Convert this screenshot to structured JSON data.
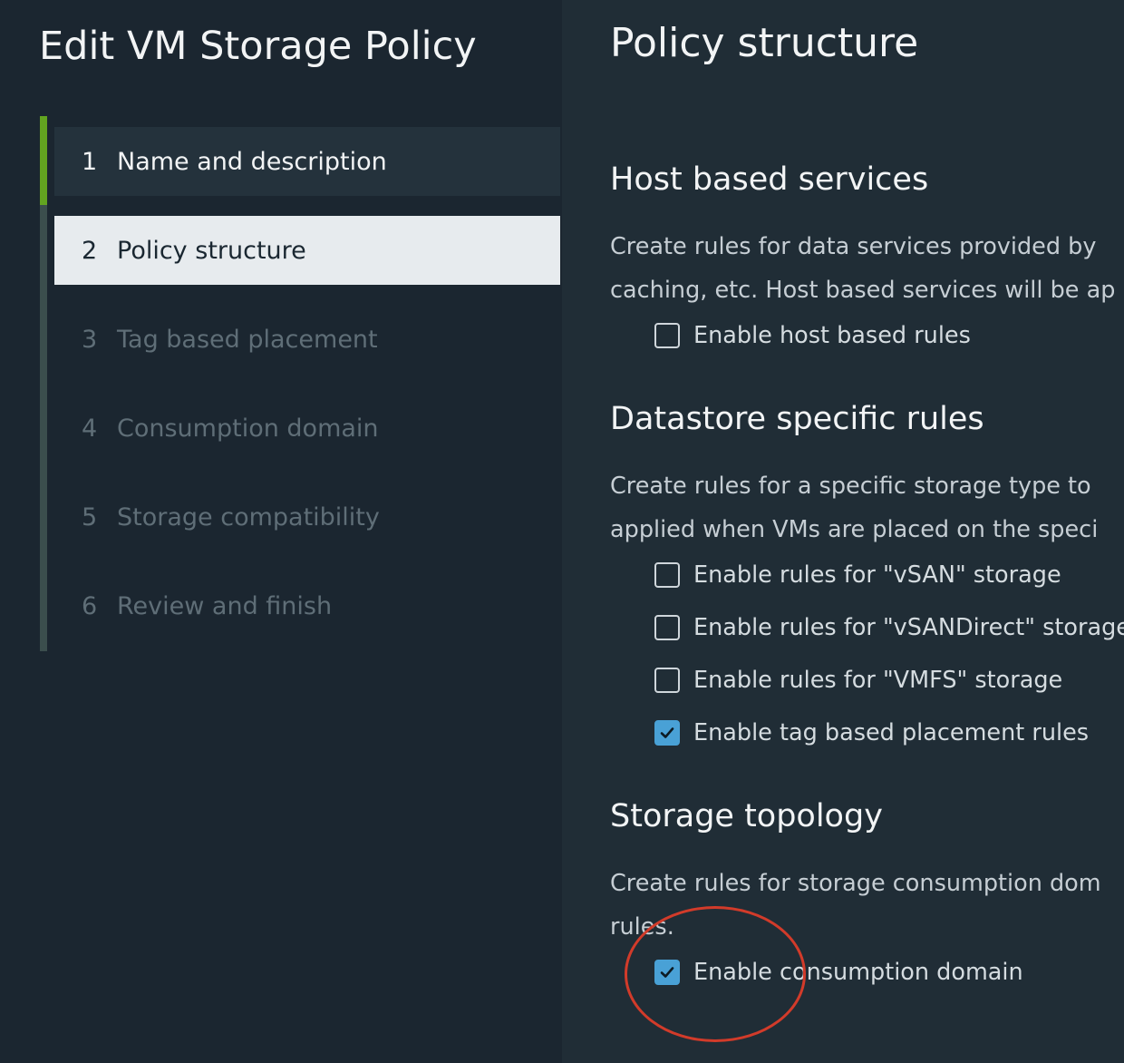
{
  "wizard": {
    "title": "Edit VM Storage Policy",
    "steps": [
      {
        "number": "1",
        "label": "Name and description",
        "state": "completed"
      },
      {
        "number": "2",
        "label": "Policy structure",
        "state": "current"
      },
      {
        "number": "3",
        "label": "Tag based placement",
        "state": "disabled"
      },
      {
        "number": "4",
        "label": "Consumption domain",
        "state": "disabled"
      },
      {
        "number": "5",
        "label": "Storage compatibility",
        "state": "disabled"
      },
      {
        "number": "6",
        "label": "Review and finish",
        "state": "disabled"
      }
    ]
  },
  "main": {
    "title": "Policy structure",
    "host_based": {
      "heading": "Host based services",
      "description_line1": "Create rules for data services provided by",
      "description_line2": "caching, etc. Host based services will be ap",
      "checkbox": {
        "label": "Enable host based rules",
        "checked": false
      }
    },
    "datastore_specific": {
      "heading": "Datastore specific rules",
      "description_line1": "Create rules for a specific storage type to",
      "description_line2": "applied when VMs are placed on the speci",
      "checkboxes": [
        {
          "label": "Enable rules for \"vSAN\" storage",
          "checked": false
        },
        {
          "label": "Enable rules for \"vSANDirect\" storage",
          "checked": false
        },
        {
          "label": "Enable rules for \"VMFS\" storage",
          "checked": false
        },
        {
          "label": "Enable tag based placement rules",
          "checked": true
        }
      ]
    },
    "storage_topology": {
      "heading": "Storage topology",
      "description_line1": "Create rules for storage consumption dom",
      "description_line2": "rules.",
      "checkbox": {
        "label": "Enable consumption domain",
        "checked": true
      }
    }
  },
  "colors": {
    "sidebar_bg": "#1b2630",
    "content_bg": "#202d36",
    "progress_accent": "#62a420",
    "checkbox_checked": "#49a1d6",
    "annotation": "#d23b2a"
  }
}
